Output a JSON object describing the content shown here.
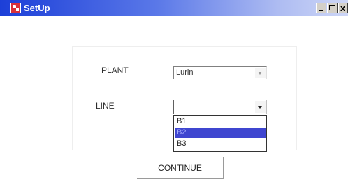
{
  "window": {
    "title": "SetUp",
    "close_glyph": "x"
  },
  "form": {
    "plant_label": "PLANT",
    "plant_value": "Lurin",
    "line_label": "LINE",
    "line_value": "",
    "line_options": [
      "B1",
      "B2",
      "B3"
    ],
    "line_highlighted": "B2",
    "continue_label": "CONTINUE"
  },
  "icons": {
    "app": "app-icon",
    "minimize": "minimize-icon",
    "maximize": "maximize-icon",
    "close": "close-icon",
    "dropdown": "chevron-down-icon"
  },
  "colors": {
    "titlebar_start": "#1c3fd8",
    "titlebar_end": "#cdd6f6",
    "selection": "#3f46d0"
  }
}
